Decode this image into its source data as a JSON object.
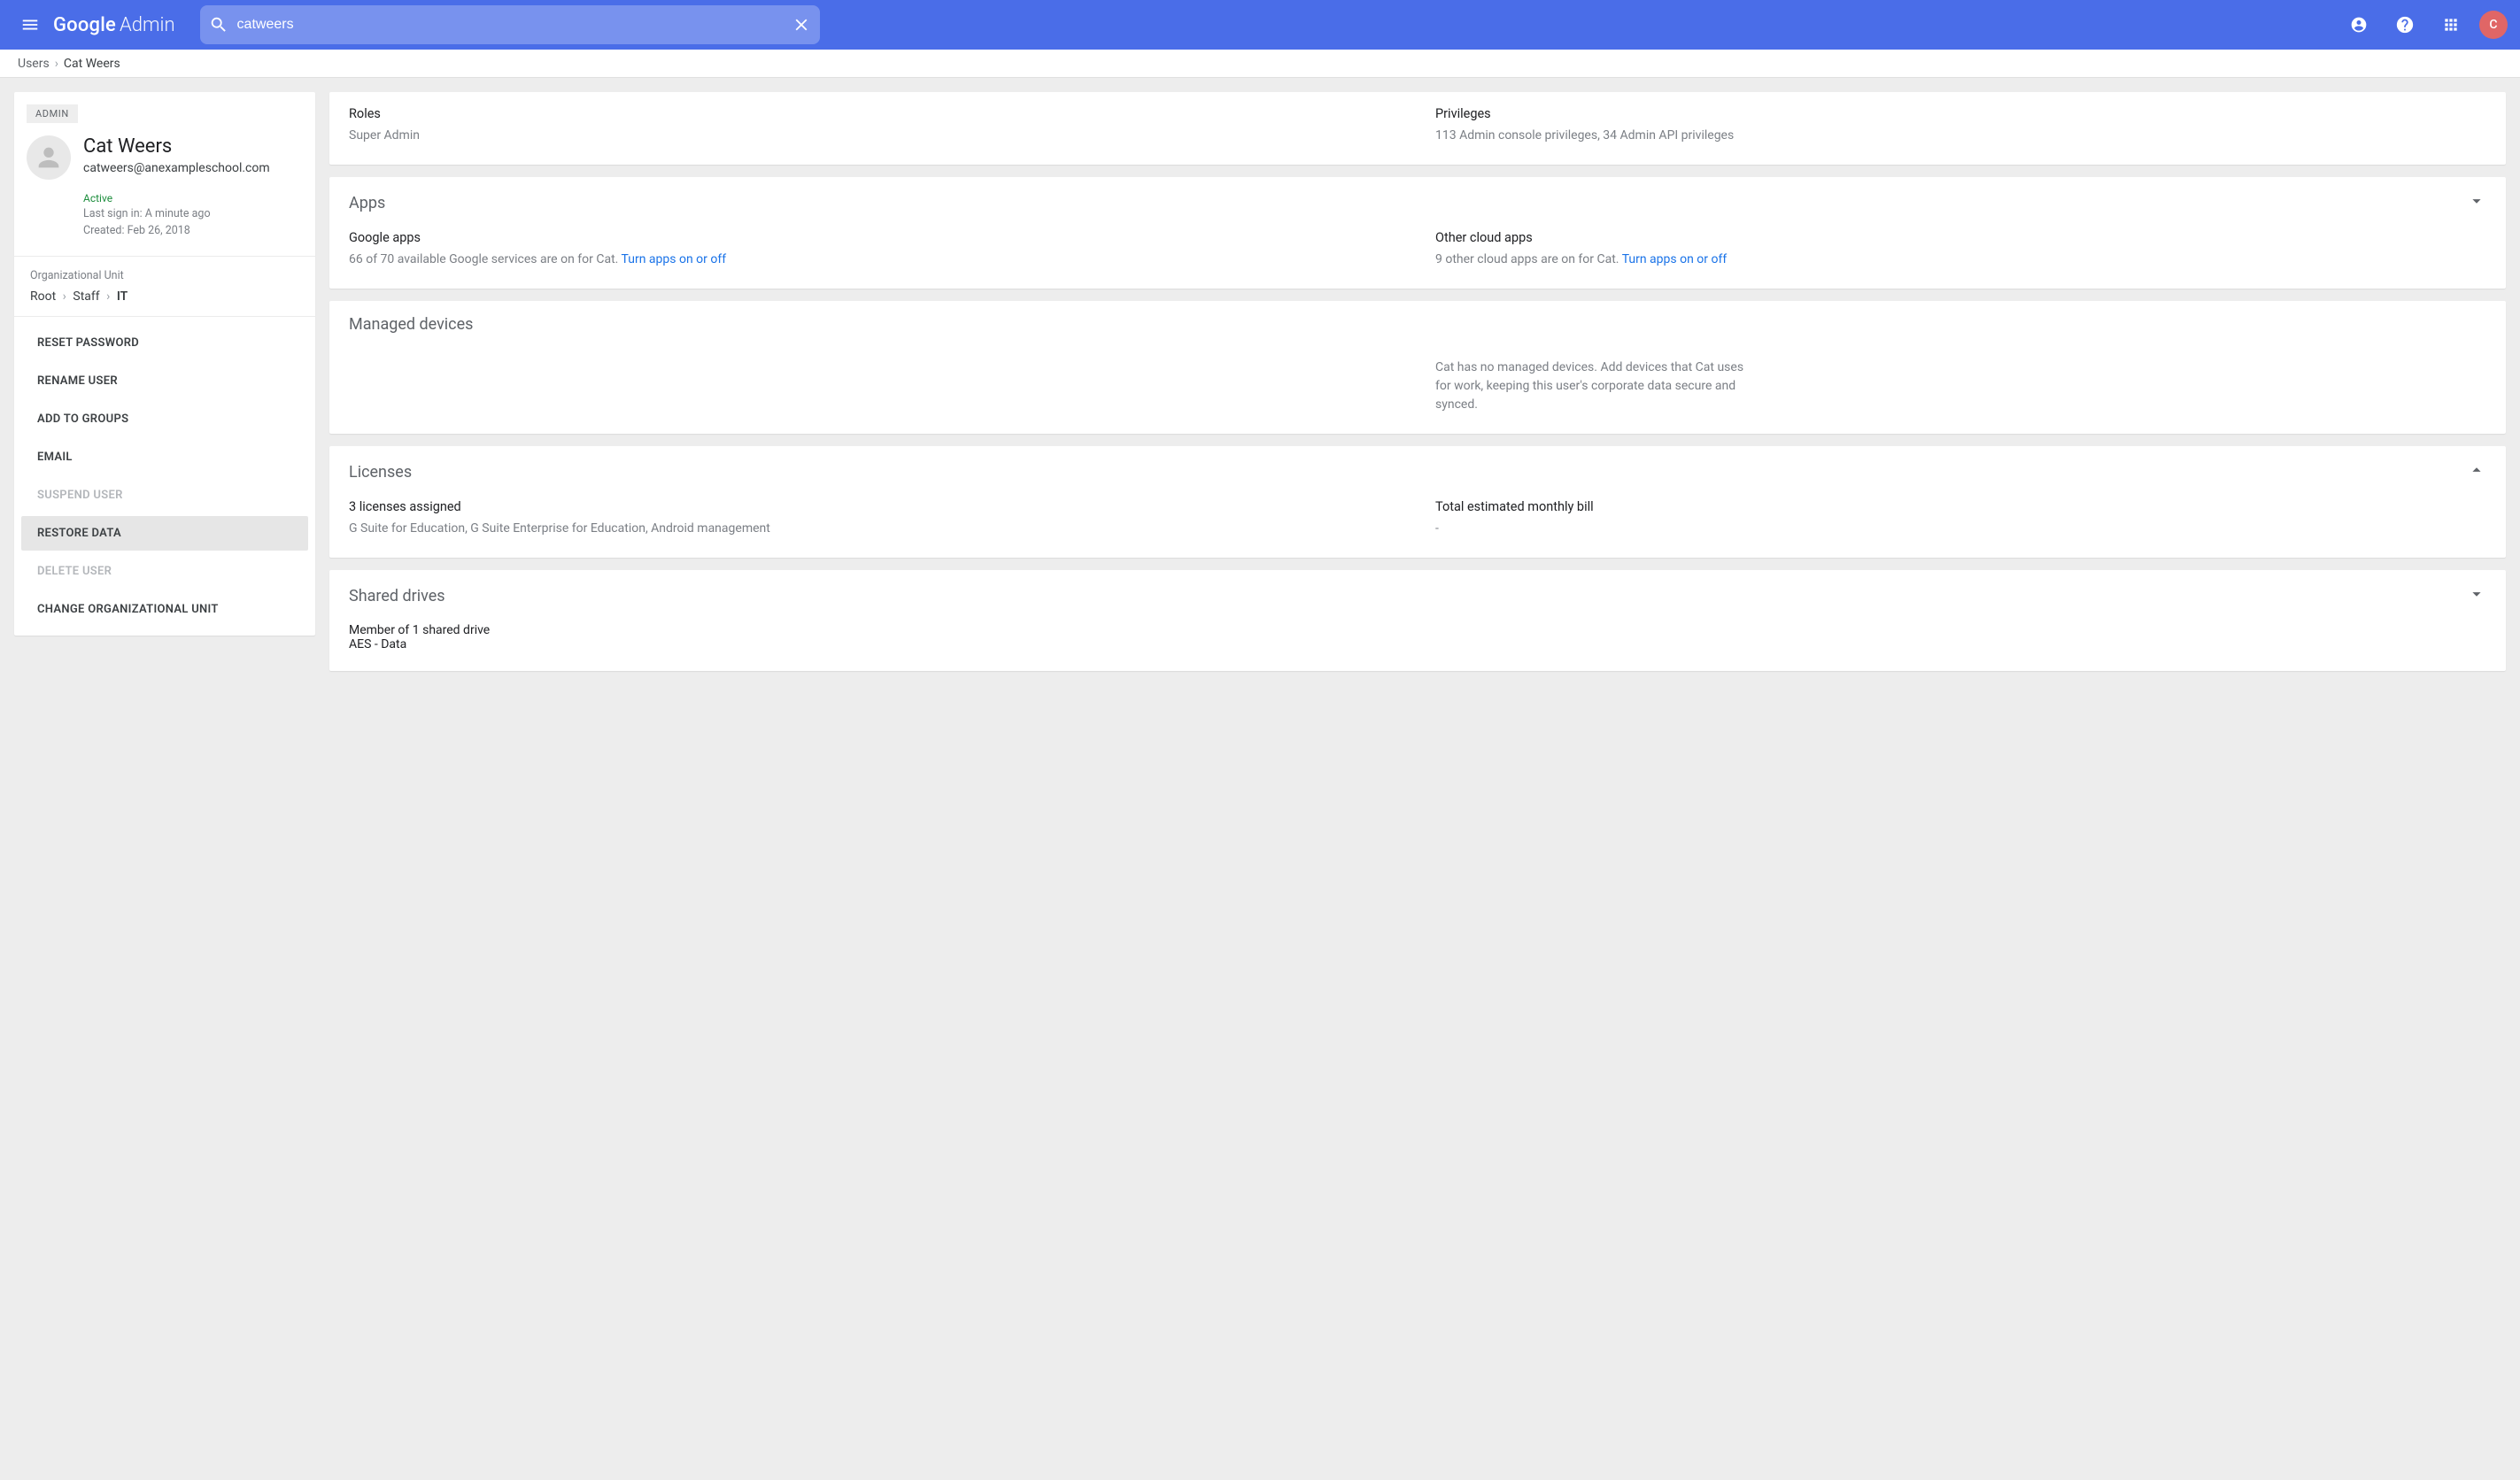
{
  "header": {
    "logo_google": "Google",
    "logo_admin": "Admin",
    "search_value": "catweers",
    "avatar_initial": "C"
  },
  "breadcrumb": {
    "parent": "Users",
    "current": "Cat Weers"
  },
  "sidebar": {
    "badge": "ADMIN",
    "name": "Cat Weers",
    "email": "catweers@anexampleschool.com",
    "status": "Active",
    "last_signin": "Last sign in: A minute ago",
    "created": "Created: Feb 26, 2018",
    "ou_label": "Organizational Unit",
    "ou_path": [
      "Root",
      "Staff",
      "IT"
    ],
    "actions": [
      {
        "label": "RESET PASSWORD",
        "muted": false,
        "selected": false
      },
      {
        "label": "RENAME USER",
        "muted": false,
        "selected": false
      },
      {
        "label": "ADD TO GROUPS",
        "muted": false,
        "selected": false
      },
      {
        "label": "EMAIL",
        "muted": false,
        "selected": false
      },
      {
        "label": "SUSPEND USER",
        "muted": true,
        "selected": false
      },
      {
        "label": "RESTORE DATA",
        "muted": false,
        "selected": true
      },
      {
        "label": "DELETE USER",
        "muted": true,
        "selected": false
      },
      {
        "label": "CHANGE ORGANIZATIONAL UNIT",
        "muted": false,
        "selected": false
      }
    ]
  },
  "main": {
    "roles_privileges": {
      "roles_label": "Roles",
      "roles_value": "Super Admin",
      "priv_label": "Privileges",
      "priv_value": "113 Admin console privileges, 34 Admin API privileges"
    },
    "apps": {
      "title": "Apps",
      "google_label": "Google apps",
      "google_body": "66 of 70 available Google services are on for Cat.",
      "google_link": "Turn apps on or off",
      "other_label": "Other cloud apps",
      "other_body": "9 other cloud apps are on for Cat.",
      "other_link": "Turn apps on or off"
    },
    "devices": {
      "title": "Managed devices",
      "body": "Cat has no managed devices. Add devices that Cat uses for work, keeping this user's corporate data secure and synced."
    },
    "licenses": {
      "title": "Licenses",
      "assigned_label": "3 licenses assigned",
      "assigned_body": "G Suite for Education, G Suite Enterprise for Education, Android management",
      "bill_label": "Total estimated monthly bill",
      "bill_value": "-"
    },
    "shared_drives": {
      "title": "Shared drives",
      "member_label": "Member of 1 shared drive",
      "member_body": "AES - Data"
    }
  }
}
